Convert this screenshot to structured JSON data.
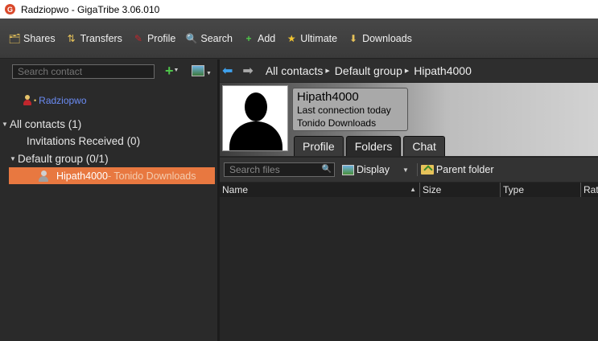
{
  "window": {
    "title": "Radziopwo - GigaTribe 3.06.010"
  },
  "toolbar": {
    "items": [
      {
        "label": "Shares",
        "icon": "shares-icon",
        "color": "#e6c25a"
      },
      {
        "label": "Transfers",
        "icon": "transfers-icon",
        "color": "#e6c25a"
      },
      {
        "label": "Profile",
        "icon": "profile-icon",
        "color": "#c0262d"
      },
      {
        "label": "Search",
        "icon": "search-icon",
        "color": "#e6c25a"
      },
      {
        "label": "Add",
        "icon": "add-icon",
        "color": "#4ec54a"
      },
      {
        "label": "Ultimate",
        "icon": "star-icon",
        "color": "#f2c531"
      },
      {
        "label": "Downloads",
        "icon": "downloads-icon",
        "color": "#e6c25a"
      }
    ]
  },
  "sidebar": {
    "search_placeholder": "Search contact",
    "me": {
      "name": "Radziopwo",
      "bullet": "•"
    },
    "tree": {
      "all_contacts": "All contacts (1)",
      "invitations": "Invitations Received  (0)",
      "default_group": "Default group (0/1)",
      "selected_user": {
        "name": "Hipath4000",
        "extra": " - Tonido Downloads"
      }
    }
  },
  "breadcrumb": {
    "items": [
      "All contacts",
      "Default group",
      "Hipath4000"
    ]
  },
  "profile": {
    "name": "Hipath4000",
    "last_connection": "Last connection today",
    "status": "Tonido Downloads"
  },
  "tabs": [
    {
      "label": "Profile",
      "active": false
    },
    {
      "label": "Folders",
      "active": true
    },
    {
      "label": "Chat",
      "active": false
    }
  ],
  "files": {
    "search_placeholder": "Search files",
    "display_label": "Display",
    "parent_label": "Parent folder",
    "columns": [
      "Name",
      "Size",
      "Type",
      "Rat"
    ]
  },
  "colors": {
    "selection": "#e87840",
    "accent_link": "#6b8cf5",
    "nav_back": "#3fa2ee"
  }
}
